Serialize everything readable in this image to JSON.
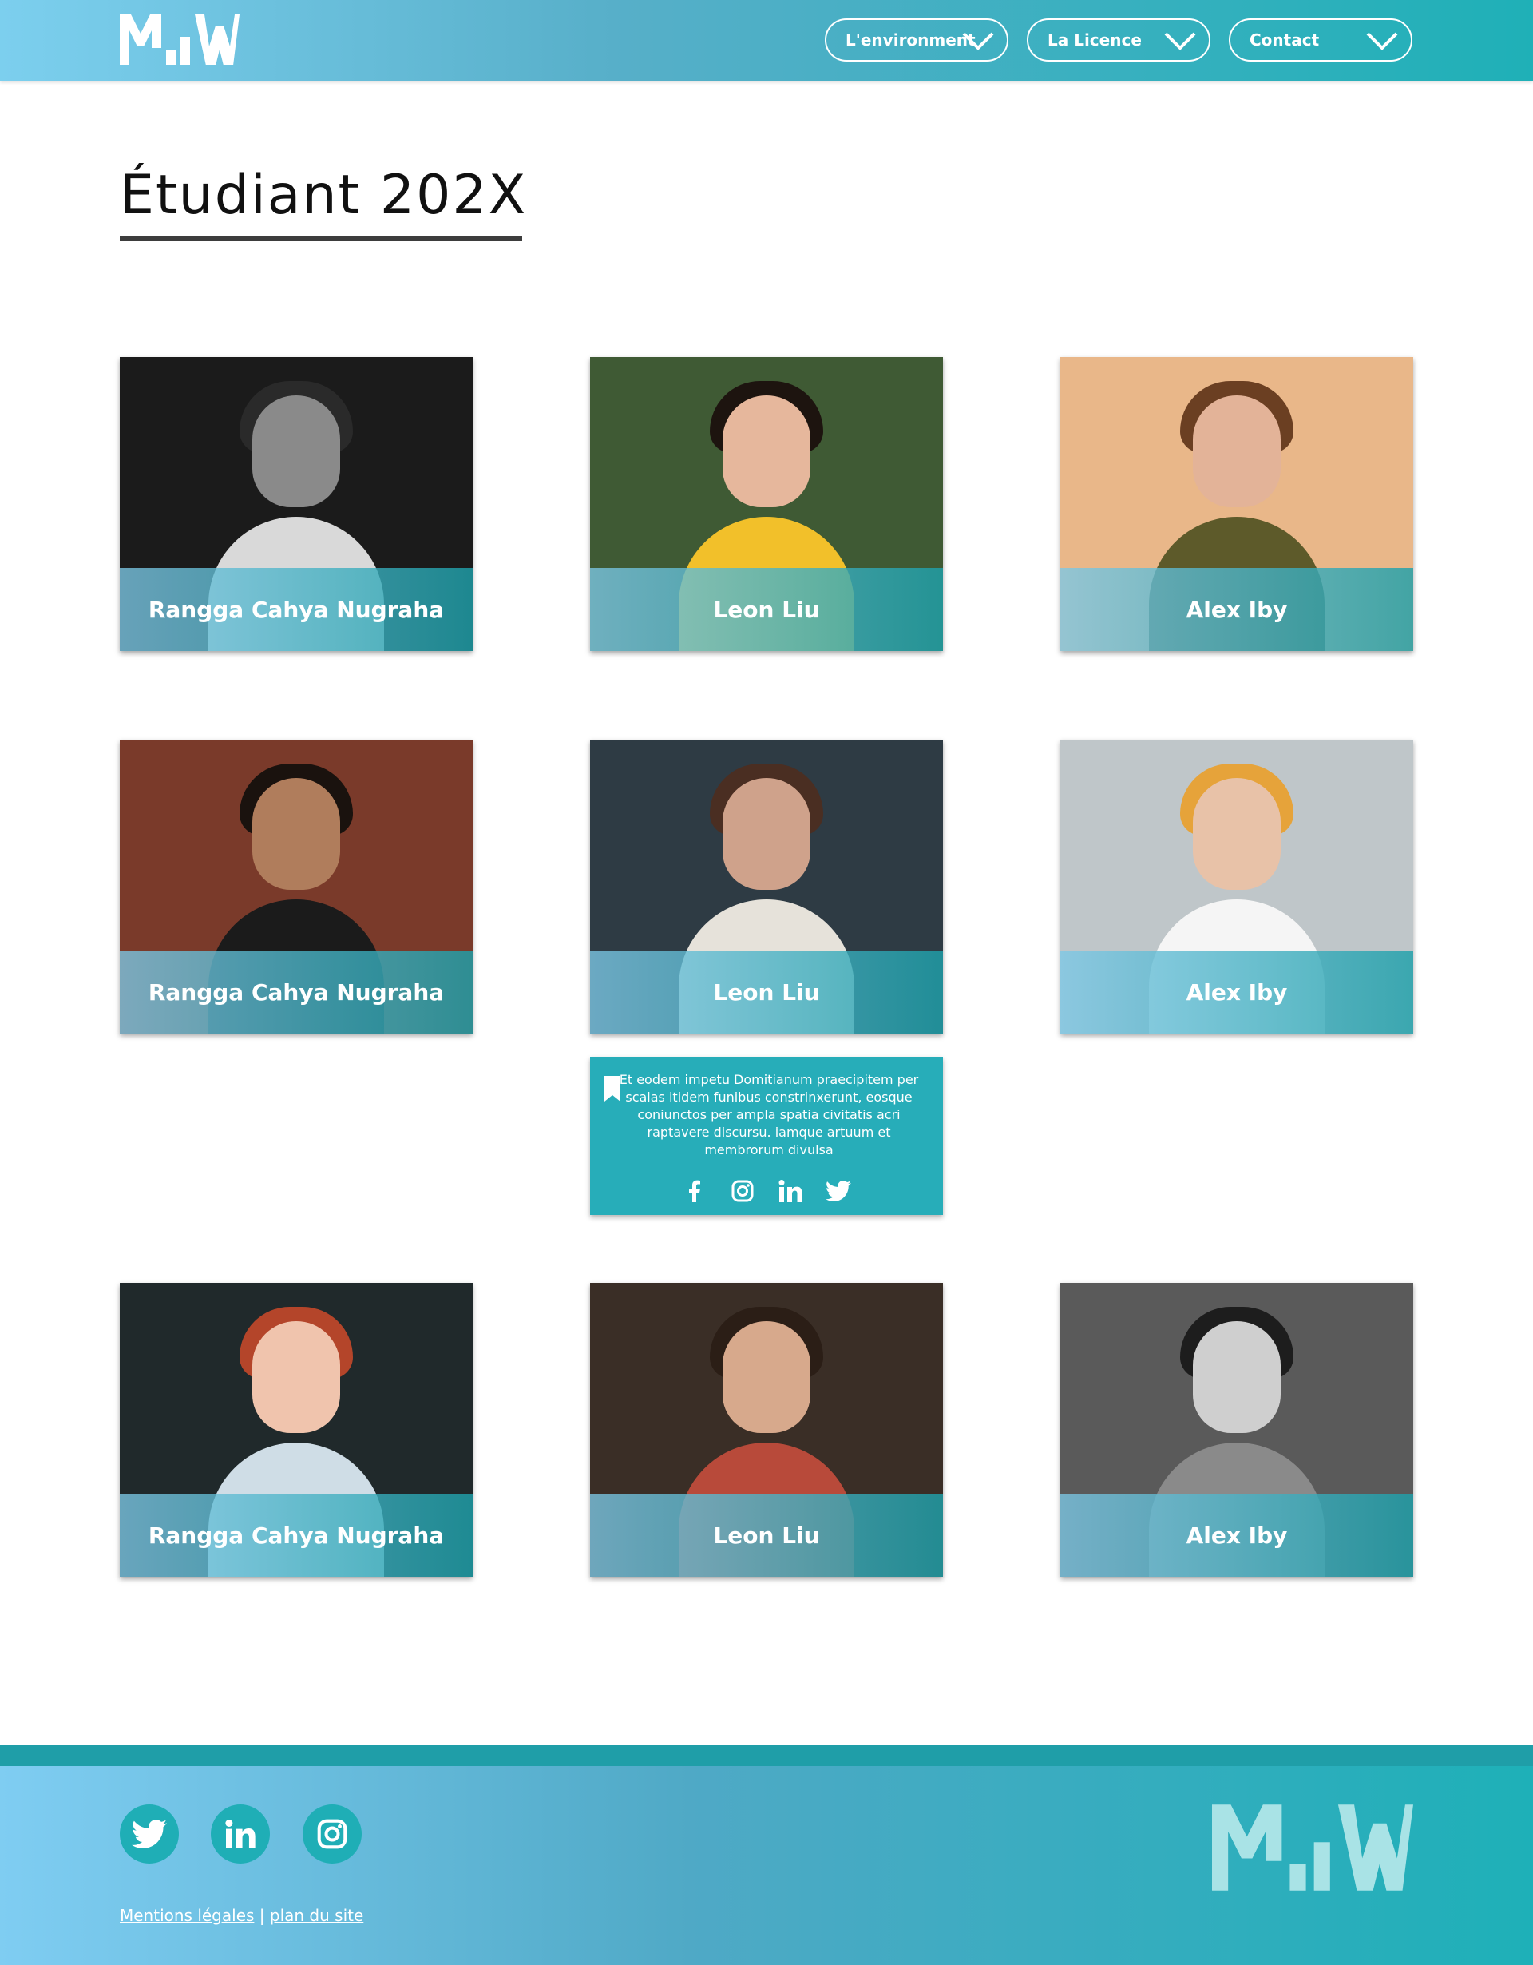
{
  "header": {
    "logo_text": "MIW",
    "nav": [
      {
        "label": "L'environment"
      },
      {
        "label": "La Licence"
      },
      {
        "label": "Contact"
      }
    ]
  },
  "page": {
    "title": "Étudiant 202X"
  },
  "students": [
    {
      "name": "Rangga Cahya Nugraha",
      "photo_palette": {
        "bg": "#1b1b1b",
        "skin": "#8a8a8a",
        "hair": "#2a2a2a",
        "shirt": "#d9d9d9"
      }
    },
    {
      "name": "Leon Liu",
      "photo_palette": {
        "bg": "#3f5a34",
        "skin": "#e6b79c",
        "hair": "#1d140f",
        "shirt": "#f2c02a"
      }
    },
    {
      "name": "Alex Iby",
      "photo_palette": {
        "bg": "#e9b789",
        "skin": "#e3b398",
        "hair": "#6b3f22",
        "shirt": "#5d5a2a"
      }
    },
    {
      "name": "Rangga Cahya Nugraha",
      "photo_palette": {
        "bg": "#7a3a2a",
        "skin": "#b07d5c",
        "hair": "#1a120e",
        "shirt": "#1b1b1b"
      }
    },
    {
      "name": "Leon Liu",
      "photo_palette": {
        "bg": "#2e3b44",
        "skin": "#cfa28b",
        "hair": "#4a2e22",
        "shirt": "#e6e2da"
      }
    },
    {
      "name": "Alex Iby",
      "photo_palette": {
        "bg": "#bfc6c9",
        "skin": "#e8c2a8",
        "hair": "#e6a33a",
        "shirt": "#f5f5f5"
      }
    },
    {
      "name": "Rangga Cahya Nugraha",
      "photo_palette": {
        "bg": "#20292b",
        "skin": "#f0c4ad",
        "hair": "#b4452a",
        "shirt": "#cfdde6"
      }
    },
    {
      "name": "Leon Liu",
      "photo_palette": {
        "bg": "#3a2e26",
        "skin": "#d7a98c",
        "hair": "#2b1e16",
        "shirt": "#b84a3a"
      }
    },
    {
      "name": "Alex Iby",
      "photo_palette": {
        "bg": "#5a5a5a",
        "skin": "#cfcfcf",
        "hair": "#1d1d1d",
        "shirt": "#8a8a8a"
      }
    }
  ],
  "detail": {
    "text": "Et eodem impetu Domitianum praecipitem per scalas itidem funibus constrinxerunt, eosque coniunctos per ampla spatia civitatis acri raptavere discursu. iamque artuum et membrorum divulsa",
    "socials": [
      "facebook-icon",
      "instagram-icon",
      "linkedin-icon",
      "twitter-icon"
    ]
  },
  "footer": {
    "socials": [
      "twitter-icon",
      "linkedin-icon",
      "instagram-icon"
    ],
    "links": {
      "legal": "Mentions légales",
      "separator": " | ",
      "sitemap": "plan du site"
    }
  },
  "colors": {
    "accent": "#1fb0b7",
    "header_start": "#7ccfee"
  }
}
